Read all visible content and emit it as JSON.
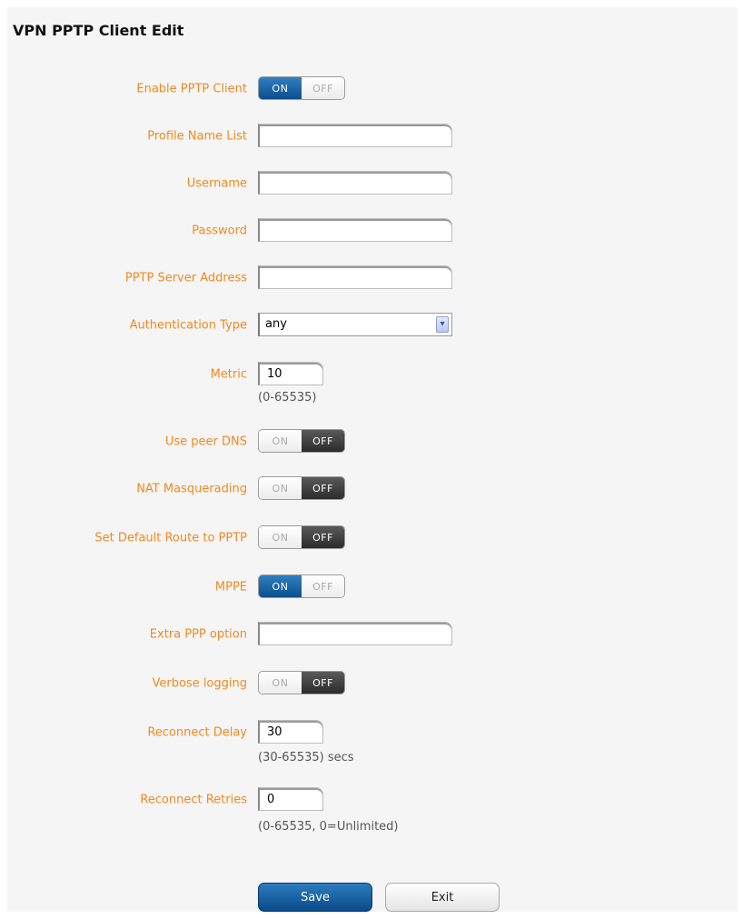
{
  "page": {
    "title": "VPN PPTP Client Edit"
  },
  "form": {
    "enable_pptp": {
      "label": "Enable PPTP Client",
      "on": "ON",
      "off": "OFF",
      "state": "on"
    },
    "profile_name": {
      "label": "Profile Name List",
      "value": ""
    },
    "username": {
      "label": "Username",
      "value": ""
    },
    "password": {
      "label": "Password",
      "value": ""
    },
    "server_address": {
      "label": "PPTP Server Address",
      "value": ""
    },
    "auth_type": {
      "label": "Authentication Type",
      "value": "any"
    },
    "metric": {
      "label": "Metric",
      "value": "10",
      "hint": "(0-65535)"
    },
    "peer_dns": {
      "label": "Use peer DNS",
      "on": "ON",
      "off": "OFF",
      "state": "off"
    },
    "nat_masq": {
      "label": "NAT Masquerading",
      "on": "ON",
      "off": "OFF",
      "state": "off"
    },
    "default_route": {
      "label": "Set Default Route to PPTP",
      "on": "ON",
      "off": "OFF",
      "state": "off"
    },
    "mppe": {
      "label": "MPPE",
      "on": "ON",
      "off": "OFF",
      "state": "on"
    },
    "extra_ppp": {
      "label": "Extra PPP option",
      "value": ""
    },
    "verbose": {
      "label": "Verbose logging",
      "on": "ON",
      "off": "OFF",
      "state": "off"
    },
    "reconnect_delay": {
      "label": "Reconnect Delay",
      "value": "30",
      "hint": "(30-65535) secs"
    },
    "reconnect_retries": {
      "label": "Reconnect Retries",
      "value": "0",
      "hint": "(0-65535, 0=Unlimited)"
    }
  },
  "buttons": {
    "save": "Save",
    "exit": "Exit"
  },
  "colors": {
    "label": "#ef8a22",
    "toggle_on": "#0b4e8f",
    "toggle_off": "#2b2b2b",
    "panel_bg": "#f5f5f5"
  }
}
